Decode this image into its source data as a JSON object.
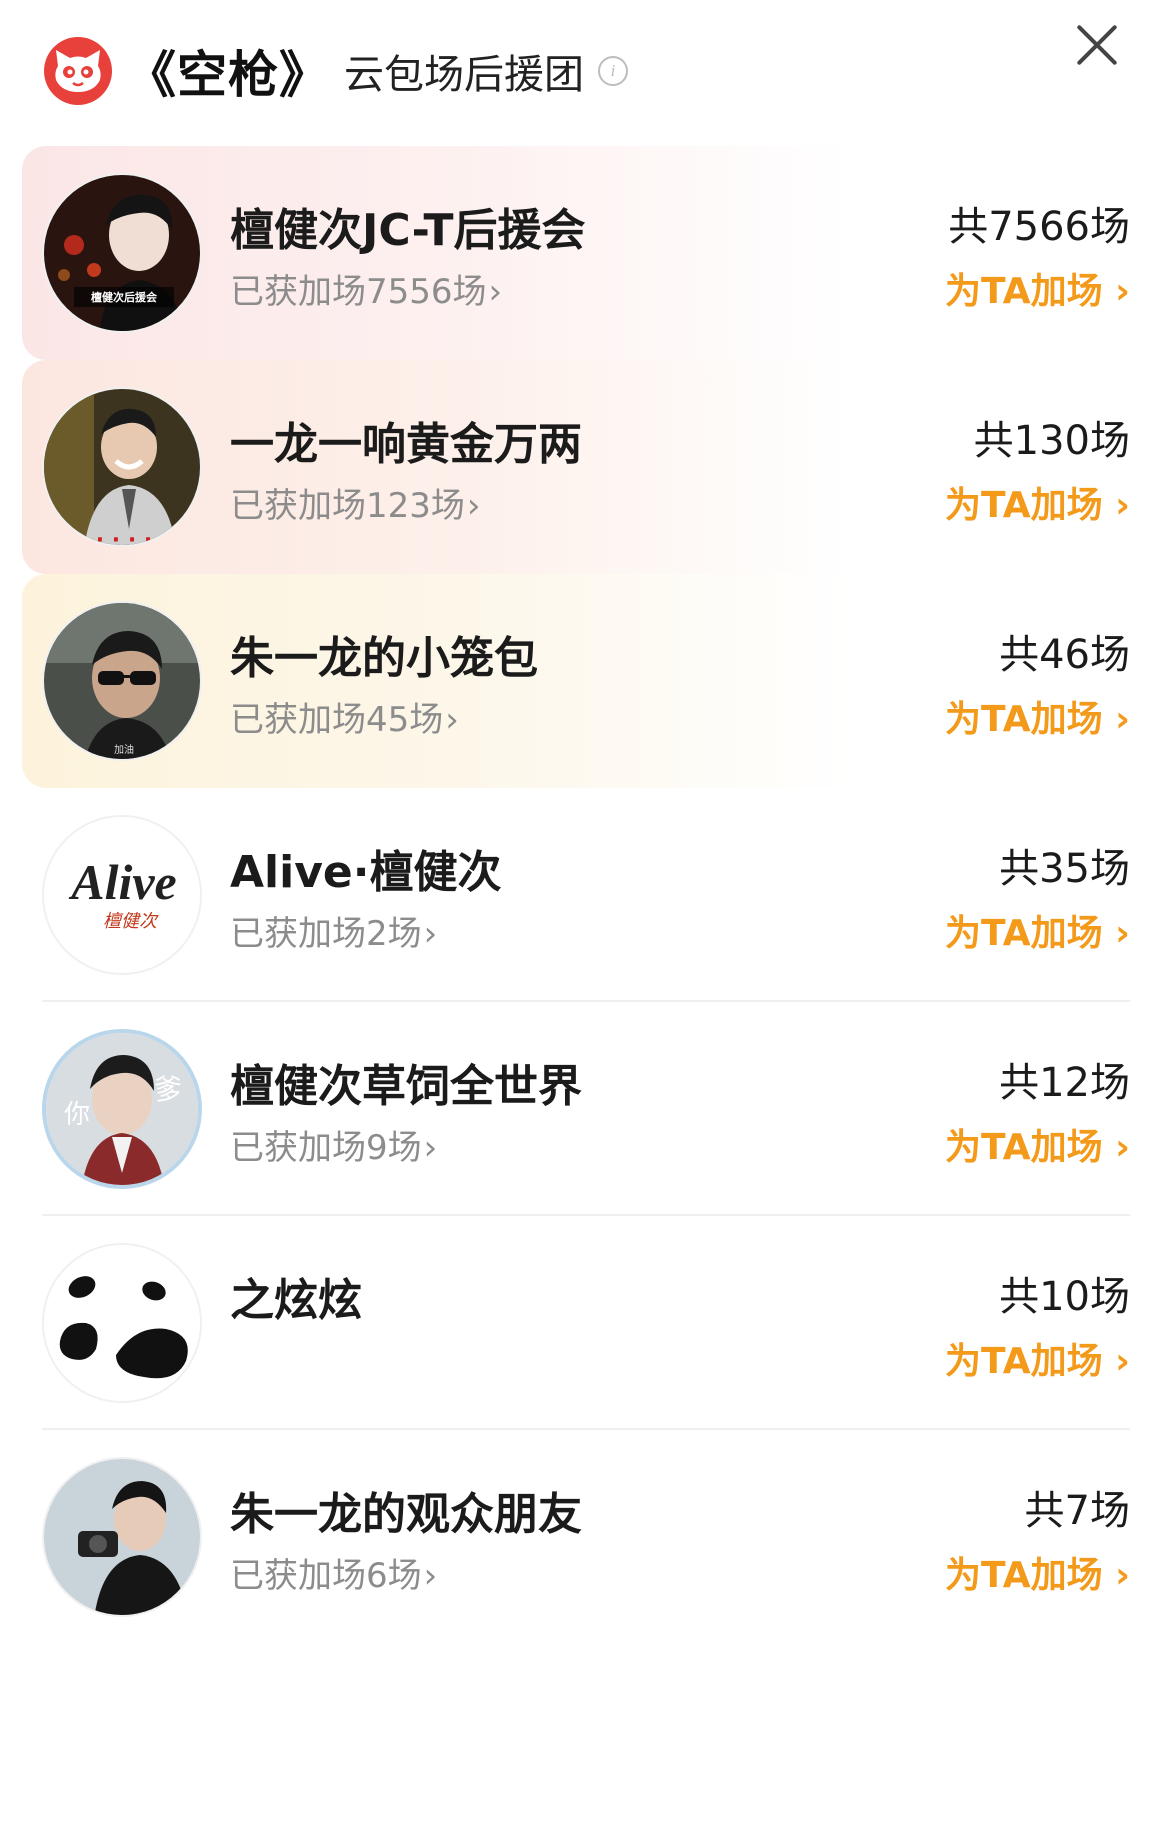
{
  "header": {
    "title": "《空枪》",
    "subtitle": "云包场后援团",
    "info_icon": "info-icon",
    "close_icon": "close-icon"
  },
  "colors": {
    "accent": "#f39a1b",
    "logo": "#e8403a"
  },
  "rows": [
    {
      "name": "檀健次JC-T后援会",
      "gained": "已获加场7556场",
      "total": "共7566场",
      "boost": "为TA加场",
      "highlight": "pink",
      "avatar": "person-photo-icon"
    },
    {
      "name": "一龙一响黄金万两",
      "gained": "已获加场123场",
      "total": "共130场",
      "boost": "为TA加场",
      "highlight": "peach",
      "avatar": "person-photo-icon"
    },
    {
      "name": "朱一龙的小笼包",
      "gained": "已获加场45场",
      "total": "共46场",
      "boost": "为TA加场",
      "highlight": "yellow",
      "avatar": "person-photo-icon"
    },
    {
      "name": "Alive·檀健次",
      "gained": "已获加场2场",
      "total": "共35场",
      "boost": "为TA加场",
      "highlight": "none",
      "avatar": "alive-logo-icon"
    },
    {
      "name": "檀健次草饲全世界",
      "gained": "已获加场9场",
      "total": "共12场",
      "boost": "为TA加场",
      "highlight": "none",
      "avatar": "person-photo-icon"
    },
    {
      "name": "之炫炫",
      "gained": "",
      "total": "共10场",
      "boost": "为TA加场",
      "highlight": "none",
      "avatar": "panda-icon"
    },
    {
      "name": "朱一龙的观众朋友",
      "gained": "已获加场6场",
      "total": "共7场",
      "boost": "为TA加场",
      "highlight": "none",
      "avatar": "person-photo-icon"
    }
  ]
}
